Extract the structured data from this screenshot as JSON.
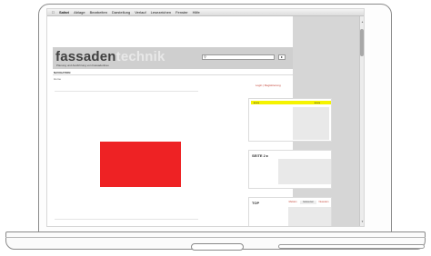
{
  "menubar": {
    "apple": "",
    "app": "Safari",
    "items": [
      "Ablage",
      "Bearbeiten",
      "Darstellung",
      "Verlauf",
      "Lesezeichen",
      "Fenster",
      "Hilfe"
    ]
  },
  "site": {
    "logo_part1": "fassaden",
    "logo_part2": "technik",
    "tagline": "Planung und Ausführung von Fassadenbau",
    "search_placeholder": "",
    "search_button": "▸",
    "nav_label": "NAVIGATION",
    "breadcrumb": "Home",
    "login_link": "Login | Registrierung"
  },
  "sidebar": {
    "box1_left": "▸ ▸ ▸",
    "box1_right": "▸ ▸ ▸",
    "box2_title": "SEITE 2 ▸",
    "box3_title": "TOP",
    "box3_tabs": [
      "Meisten",
      "Gelesenen",
      "Neuesten"
    ]
  },
  "colors": {
    "ad_red": "#ee2224",
    "accent_yellow": "#f5f300"
  }
}
